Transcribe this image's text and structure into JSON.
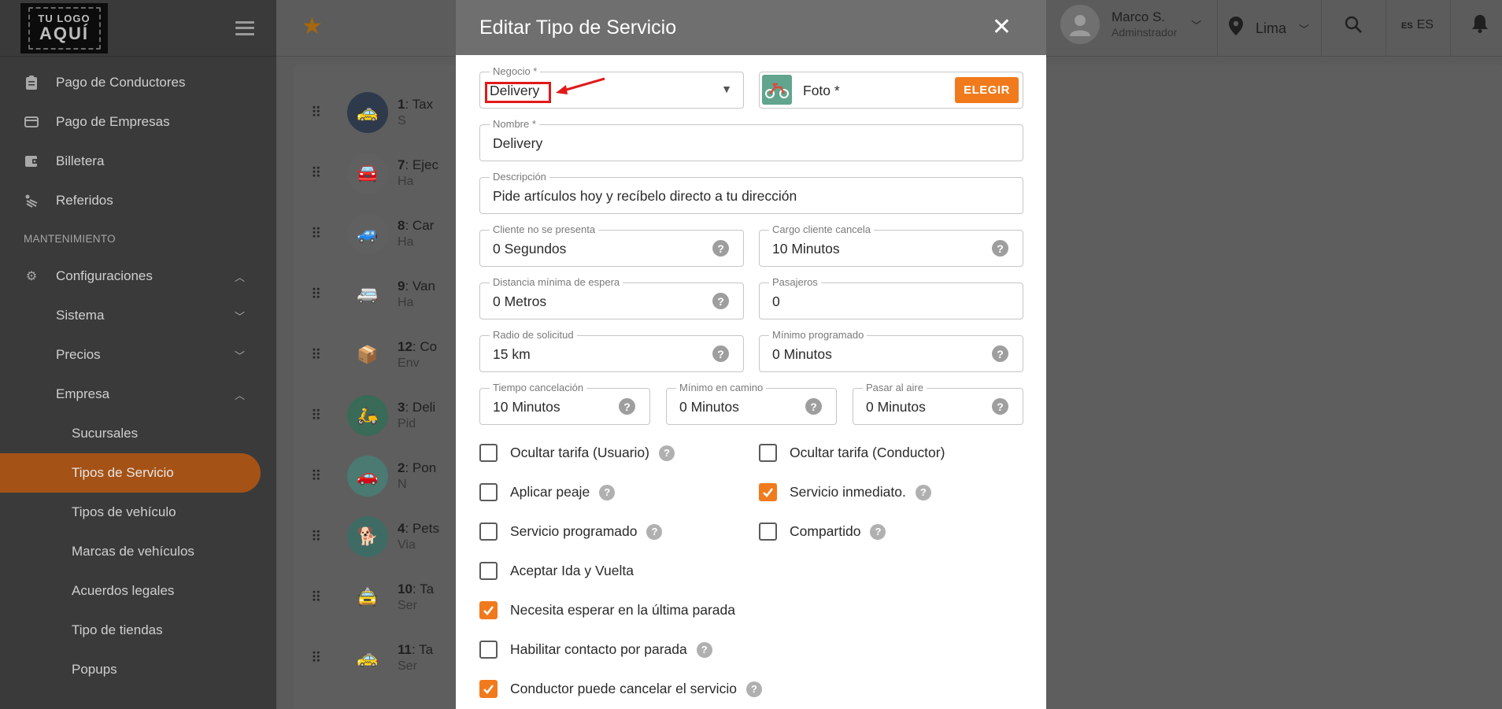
{
  "sidebar": {
    "logo_line1": "TU LOGO",
    "logo_line2": "AQUÍ",
    "items": [
      {
        "label": "Pago de Conductores",
        "icon": "clipboard-icon"
      },
      {
        "label": "Pago de Empresas",
        "icon": "credit-card-icon"
      },
      {
        "label": "Billetera",
        "icon": "wallet-icon"
      },
      {
        "label": "Referidos",
        "icon": "share-icon"
      }
    ],
    "section_title": "MANTENIMIENTO",
    "config_label": "Configuraciones",
    "sistema_label": "Sistema",
    "precios_label": "Precios",
    "empresa_label": "Empresa",
    "empresa_sub": [
      "Sucursales",
      "Tipos de Servicio",
      "Tipos de vehículo",
      "Marcas de vehículos",
      "Acuerdos legales",
      "Tipo de tiendas",
      "Popups"
    ],
    "active_item": "Tipos de Servicio",
    "active_color": "#a55216"
  },
  "header": {
    "user_name": "Marco S.",
    "user_role": "Adminstrador",
    "city": "Lima",
    "lang_code": "ES",
    "lang_label": "ES"
  },
  "services": [
    {
      "num": "1",
      "name": "Tax",
      "sub": "S"
    },
    {
      "num": "7",
      "name": "Ejec",
      "sub": "Ha"
    },
    {
      "num": "8",
      "name": "Car",
      "sub": "Ha"
    },
    {
      "num": "9",
      "name": "Van",
      "sub": "Ha"
    },
    {
      "num": "12",
      "name": "Co",
      "sub": "Env"
    },
    {
      "num": "3",
      "name": "Deli",
      "sub": "Pid"
    },
    {
      "num": "2",
      "name": "Pon",
      "sub": "N"
    },
    {
      "num": "4",
      "name": "Pets",
      "sub": "Via"
    },
    {
      "num": "10",
      "name": "Ta",
      "sub": "Ser"
    },
    {
      "num": "11",
      "name": "Ta",
      "sub": "Ser"
    }
  ],
  "modal": {
    "title": "Editar Tipo de Servicio",
    "negocio": {
      "label": "Negocio *",
      "value": "Delivery"
    },
    "foto": {
      "label": "Foto *",
      "button": "ELEGIR"
    },
    "nombre": {
      "label": "Nombre *",
      "value": "Delivery"
    },
    "descripcion": {
      "label": "Descripción",
      "value": "Pide artículos hoy y recíbelo directo a tu dirección"
    },
    "cliente_no_presenta": {
      "label": "Cliente no se presenta",
      "value": "0 Segundos"
    },
    "cargo_cliente_cancela": {
      "label": "Cargo cliente cancela",
      "value": "10 Minutos"
    },
    "distancia_minima": {
      "label": "Distancia mínima de espera",
      "value": "0 Metros"
    },
    "pasajeros": {
      "label": "Pasajeros",
      "value": "0"
    },
    "radio_solicitud": {
      "label": "Radio de solicitud",
      "value": "15 km"
    },
    "minimo_programado": {
      "label": "Mínimo programado",
      "value": "0 Minutos"
    },
    "tiempo_cancelacion": {
      "label": "Tiempo cancelación",
      "value": "10 Minutos"
    },
    "minimo_en_camino": {
      "label": "Mínimo en camino",
      "value": "0 Minutos"
    },
    "pasar_al_aire": {
      "label": "Pasar al aire",
      "value": "0 Minutos"
    },
    "checks": {
      "ocultar_tarifa_usuario": {
        "label": "Ocultar tarifa (Usuario)",
        "checked": false
      },
      "ocultar_tarifa_conductor": {
        "label": "Ocultar tarifa (Conductor)",
        "checked": false
      },
      "aplicar_peaje": {
        "label": "Aplicar peaje",
        "checked": false
      },
      "servicio_inmediato": {
        "label": "Servicio inmediato.",
        "checked": true
      },
      "servicio_programado": {
        "label": "Servicio programado",
        "checked": false
      },
      "compartido": {
        "label": "Compartido",
        "checked": false
      },
      "ida_vuelta": {
        "label": "Aceptar Ida y Vuelta",
        "checked": false
      },
      "esperar_ultima_parada": {
        "label": "Necesita esperar en la última parada",
        "checked": true
      },
      "contacto_por_parada": {
        "label": "Habilitar contacto por parada",
        "checked": false
      },
      "conductor_cancela": {
        "label": "Conductor puede cancelar el servicio",
        "checked": true
      }
    },
    "accent_color": "#f07a1c"
  }
}
